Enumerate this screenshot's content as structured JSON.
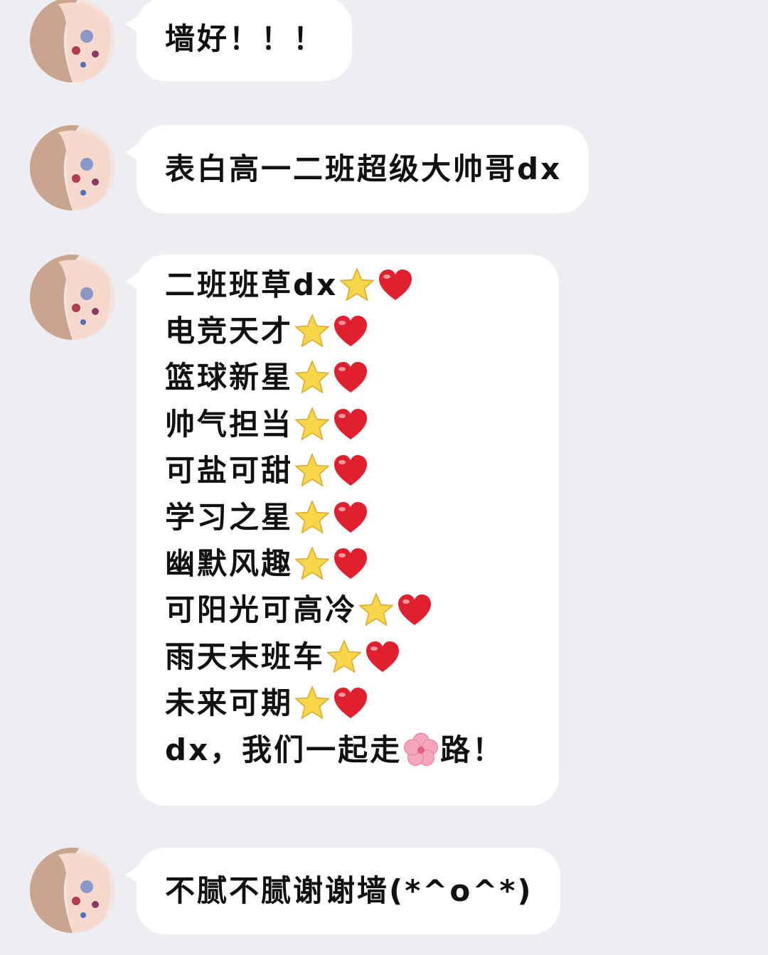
{
  "messages": [
    {
      "text": "墙好！！！"
    },
    {
      "text": "表白高一二班超级大帅哥dx"
    },
    {
      "lines": [
        {
          "text": "二班班草dx",
          "emojis": [
            "star",
            "heart"
          ]
        },
        {
          "text": "电竞天才",
          "emojis": [
            "star",
            "heart"
          ]
        },
        {
          "text": "篮球新星",
          "emojis": [
            "star",
            "heart"
          ]
        },
        {
          "text": "帅气担当",
          "emojis": [
            "star",
            "heart"
          ]
        },
        {
          "text": "可盐可甜",
          "emojis": [
            "star",
            "heart"
          ]
        },
        {
          "text": "学习之星",
          "emojis": [
            "star",
            "heart"
          ]
        },
        {
          "text": "幽默风趣",
          "emojis": [
            "star",
            "heart"
          ]
        },
        {
          "text": "可阳光可高冷",
          "emojis": [
            "star",
            "heart"
          ]
        },
        {
          "text": "雨天末班车",
          "emojis": [
            "star",
            "heart"
          ]
        },
        {
          "text": "未来可期",
          "emojis": [
            "star",
            "heart"
          ]
        },
        {
          "text_before": "dx，我们一起走",
          "emoji": "cherry-blossom",
          "text_after": "路！"
        }
      ]
    },
    {
      "text": "不腻不腻谢谢墙(*^o^*)"
    }
  ],
  "colors": {
    "background": "#eceef2",
    "bubble": "#ffffff",
    "text": "#111111",
    "star": "#f7d64a",
    "heart": "#e0202e",
    "blossom": "#f4a6bd"
  }
}
